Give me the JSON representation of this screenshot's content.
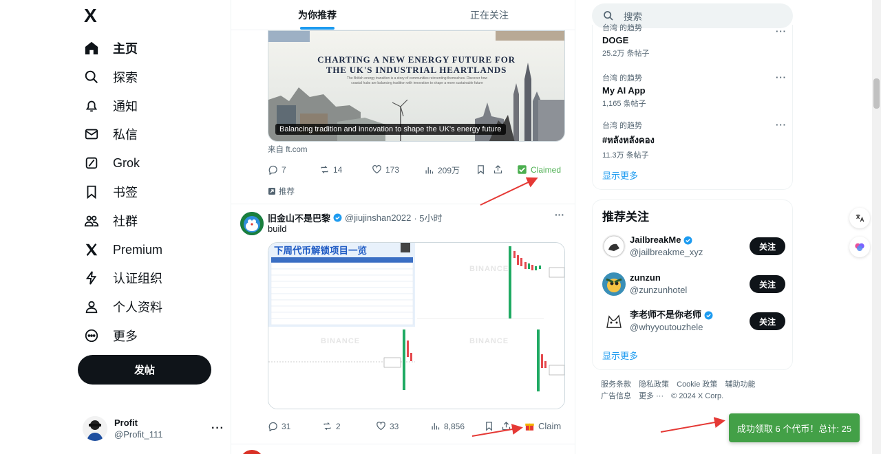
{
  "nav": {
    "logo": "X",
    "items": [
      {
        "label": "主页",
        "icon": "home-icon"
      },
      {
        "label": "探索",
        "icon": "search-icon"
      },
      {
        "label": "通知",
        "icon": "bell-icon"
      },
      {
        "label": "私信",
        "icon": "mail-icon"
      },
      {
        "label": "Grok",
        "icon": "grok-icon"
      },
      {
        "label": "书签",
        "icon": "bookmark-icon"
      },
      {
        "label": "社群",
        "icon": "people-icon"
      },
      {
        "label": "Premium",
        "icon": "x-logo-icon"
      },
      {
        "label": "认证组织",
        "icon": "lightning-icon"
      },
      {
        "label": "个人资料",
        "icon": "person-icon"
      },
      {
        "label": "更多",
        "icon": "more-circle-icon"
      }
    ],
    "post_button": "发帖"
  },
  "account": {
    "name": "Profit",
    "handle": "@Profit_111",
    "more": "···"
  },
  "tabs": {
    "for_you": "为你推荐",
    "following": "正在关注"
  },
  "post1": {
    "image_headline_1": "CHARTING A NEW ENERGY FUTURE FOR",
    "image_headline_2": "THE UK'S INDUSTRIAL HEARTLANDS",
    "image_sub": "The British energy transition is a story of communities reinventing themselves. Discover how coastal hubs are balancing tradition with innovation to shape a more sustainable future",
    "image_caption": "Balancing tradition and innovation to shape the UK's energy future",
    "source": "来自 ft.com",
    "replies": "7",
    "reposts": "14",
    "likes": "173",
    "views": "209万",
    "claimed": "Claimed",
    "promoted": "推荐"
  },
  "post2": {
    "name": "旧金山不是巴黎",
    "handle": "@jiujinshan2022",
    "time": "· 5小时",
    "text": "build",
    "image_title": "下周代币解锁项目一览",
    "watermark": "BINANCE",
    "replies": "31",
    "reposts": "2",
    "likes": "33",
    "views": "8,856",
    "claim": "Claim"
  },
  "search": {
    "placeholder": "搜索"
  },
  "trends": [
    {
      "context": "台湾 的趋势",
      "title": "DOGE",
      "count": "25.2万 条帖子"
    },
    {
      "context": "台湾 的趋势",
      "title": "My AI App",
      "count": "1,165 条帖子"
    },
    {
      "context": "台湾 的趋势",
      "title": "#หลังหลังคอง",
      "count": "11.3万 条帖子"
    }
  ],
  "trends_show_more": "显示更多",
  "who_to_follow": {
    "title": "推荐关注",
    "users": [
      {
        "name": "JailbreakMe",
        "handle": "@jailbreakme_xyz",
        "verified": true
      },
      {
        "name": "zunzun",
        "handle": "@zunzunhotel",
        "verified": false
      },
      {
        "name": "李老师不是你老师",
        "handle": "@whyyoutouzhele",
        "verified": true
      }
    ],
    "follow_label": "关注",
    "show_more": "显示更多"
  },
  "footer": {
    "links": [
      "服务条款",
      "隐私政策",
      "Cookie 政策",
      "辅助功能",
      "广告信息",
      "更多 ···"
    ],
    "copyright": "© 2024 X Corp."
  },
  "toast": "成功领取 6 个代币！总计: 25",
  "colors": {
    "accent": "#1d9bf0",
    "claimed_green": "#4caf50",
    "toast_green": "#43a047",
    "arrow_red": "#e53935"
  }
}
